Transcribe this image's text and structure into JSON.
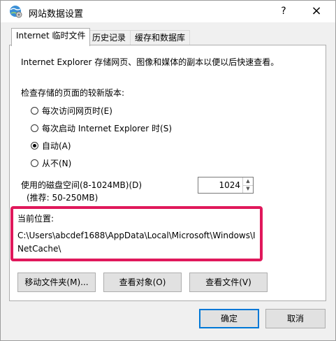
{
  "window": {
    "title": "网站数据设置",
    "help": "?",
    "close": "×"
  },
  "tabs": [
    {
      "label": "Internet 临时文件",
      "active": true
    },
    {
      "label": "历史记录",
      "active": false
    },
    {
      "label": "缓存和数据库",
      "active": false
    }
  ],
  "temp_files": {
    "description": "Internet Explorer 存储网页、图像和媒体的副本以便以后快速查看。",
    "check_label": "检查存储的页面的较新版本:",
    "options": [
      {
        "label": "每次访问网页时(E)",
        "checked": false
      },
      {
        "label": "每次启动 Internet Explorer 时(S)",
        "checked": false
      },
      {
        "label": "自动(A)",
        "checked": true
      },
      {
        "label": "从不(N)",
        "checked": false
      }
    ],
    "disk_label": "使用的磁盘空间(8-1024MB)(D)",
    "disk_sub": "(推荐: 50-250MB)",
    "disk_value": "1024",
    "location_label": "当前位置:",
    "location_path": "C:\\Users\\abcdef1688\\AppData\\Local\\Microsoft\\Windows\\INetCache\\",
    "buttons": {
      "move": "移动文件夹(M)...",
      "view_objects": "查看对象(O)",
      "view_files": "查看文件(V)"
    }
  },
  "footer": {
    "ok": "确定",
    "cancel": "取消"
  },
  "colors": {
    "highlight": "#e0185b",
    "primary_border": "#0078d7"
  },
  "icons": {
    "app": "globe-settings-icon",
    "spin_up": "chevron-up-icon",
    "spin_down": "chevron-down-icon"
  }
}
